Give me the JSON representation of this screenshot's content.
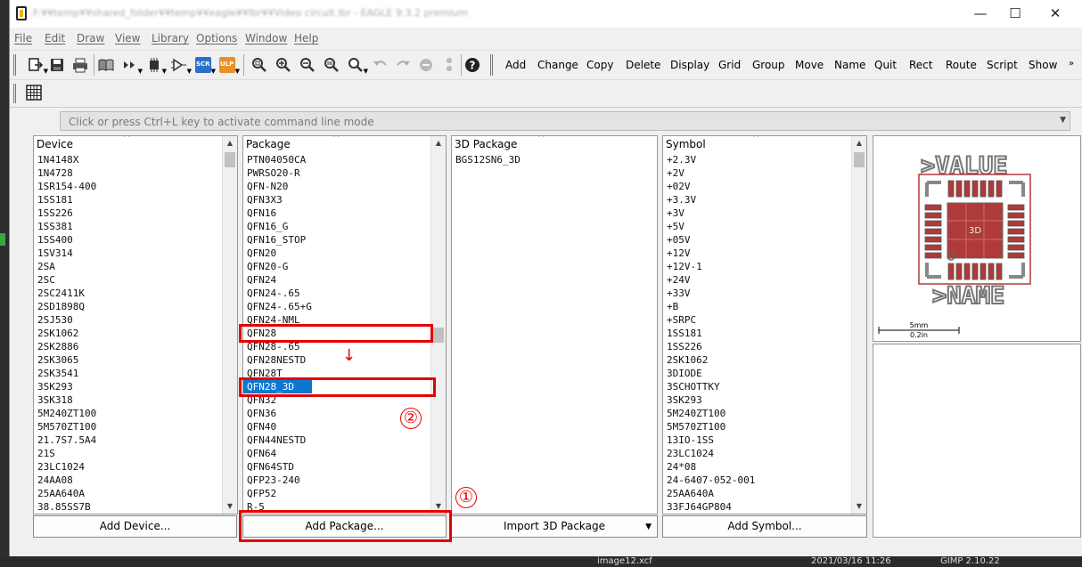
{
  "window": {
    "title": "F:¥¥temp¥¥shared_folder¥¥temp¥¥eagle¥¥lbr¥¥Video circuit.lbr - EAGLE 9.3.2 premium",
    "minimize": "—",
    "maximize": "☐",
    "close": "✕"
  },
  "menu": [
    "File",
    "Edit",
    "Draw",
    "View",
    "Library",
    "Options",
    "Window",
    "Help"
  ],
  "toolbar": {
    "commands": [
      "Add",
      "Change",
      "Copy",
      "Delete",
      "Display",
      "Grid",
      "Group",
      "Move",
      "Name",
      "Quit",
      "Rect",
      "Route",
      "Script",
      "Show"
    ],
    "overflow": "»",
    "scr_label": "SCR",
    "ulp_label": "ULP"
  },
  "commandline": {
    "placeholder": "Click or press Ctrl+L key to activate command line mode",
    "dropdown": "▼"
  },
  "device": {
    "header": "Device",
    "caret": "^",
    "items": [
      "1N4148X",
      "1N4728",
      "1SR154-400",
      "1SS181",
      "1SS226",
      "1SS381",
      "1SS400",
      "1SV314",
      "2SA",
      "2SC",
      "2SC2411K",
      "2SD1898Q",
      "2SJ530",
      "2SK1062",
      "2SK2886",
      "2SK3065",
      "2SK3541",
      "3SK293",
      "3SK318",
      "5M240ZT100",
      "5M570ZT100",
      "21.7S7.5A4",
      "21S",
      "23LC1024",
      "24AA08",
      "25AA640A",
      "38.85SS7B"
    ],
    "button": "Add Device..."
  },
  "package": {
    "header": "Package",
    "caret": "^",
    "items": [
      "PTN04050CA",
      "PWRSO20-R",
      "QFN-N20",
      "QFN3X3",
      "QFN16",
      "QFN16_G",
      "QFN16_STOP",
      "QFN20",
      "QFN20-G",
      "QFN24",
      "QFN24-.65",
      "QFN24-.65+G",
      "QFN24-NML",
      "QFN28",
      "QFN28-.65",
      "QFN28NESTD",
      "QFN28T",
      "QFN28_3D",
      "QFN32",
      "QFN36",
      "QFN40",
      "QFN44NESTD",
      "QFN64",
      "QFN64STD",
      "QFP23-240",
      "QFP52",
      "R-5"
    ],
    "selected_index": 17,
    "button": "Add Package..."
  },
  "package3d": {
    "header": "3D Package",
    "caret": "^",
    "items": [
      "BGS12SN6_3D"
    ],
    "button": "Import 3D Package",
    "button_arrow": "▼"
  },
  "symbol": {
    "header": "Symbol",
    "caret": "^",
    "items": [
      "+2.3V",
      "+2V",
      "+02V",
      "+3.3V",
      "+3V",
      "+5V",
      "+05V",
      "+12V",
      "+12V-1",
      "+24V",
      "+33V",
      "+B",
      "+SRPC",
      "1SS181",
      "1SS226",
      "2SK1062",
      "3DIODE",
      "3SCHOTTKY",
      "3SK293",
      "5M240ZT100",
      "5M570ZT100",
      "13IO-1SS",
      "23LC1024",
      "24*08",
      "24-6407-052-001",
      "25AA640A",
      "33FJ64GP804"
    ],
    "button": "Add Symbol..."
  },
  "preview": {
    "value_label": ">VALUE",
    "name_label": ">NAME",
    "center_label": "3D",
    "scale_mm": "5mm",
    "scale_in": "0.2in"
  },
  "annotations": {
    "step1": "①",
    "step2": "②",
    "arrow": "↓"
  },
  "taskbar": {
    "file": "image12.xcf",
    "date": "2021/03/16 11:26",
    "app": "GIMP 2.10.22"
  },
  "scroll": {
    "up": "▲",
    "down": "▼"
  },
  "colors": {
    "selection": "#0a78d0",
    "annotation": "#e60000",
    "pad": "#b03a3a",
    "outline": "#888888"
  }
}
